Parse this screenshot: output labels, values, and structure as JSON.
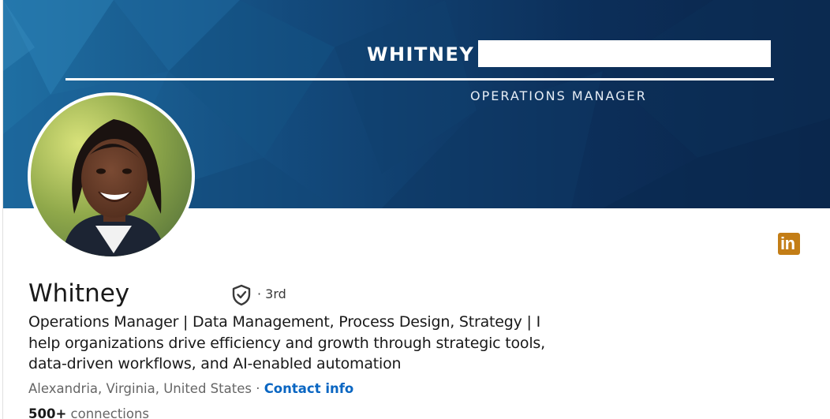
{
  "banner": {
    "name": "WHITNEY",
    "title": "OPERATIONS MANAGER"
  },
  "profile": {
    "name": "Whitney",
    "degree": "· 3rd",
    "headline": "Operations Manager | Data Management, Process Design, Strategy | I help organizations drive efficiency and growth through strategic tools, data-driven workflows, and AI-enabled automation",
    "location": "Alexandria, Virginia, United States",
    "separator": " · ",
    "contact_info": "Contact info",
    "connections_count": "500+",
    "connections_label": " connections"
  },
  "icons": {
    "verification": "shield-check-icon",
    "linkedin": "linkedin-icon",
    "linkedin_text": "in"
  },
  "colors": {
    "banner_bg": "#0c2d55",
    "link": "#0a66c2",
    "linkedin_badge": "#c37d16",
    "text_primary": "#191919",
    "text_secondary": "#666666"
  }
}
